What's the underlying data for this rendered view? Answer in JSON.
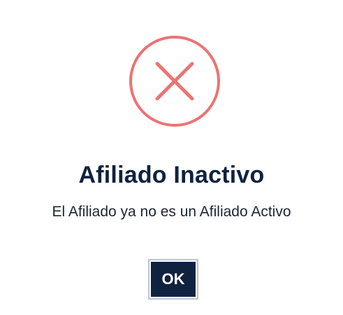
{
  "dialog": {
    "icon": "error-x-circle-icon",
    "icon_color": "#ec7373",
    "title": "Afiliado Inactivo",
    "message": "El Afiliado ya no es un Afiliado Activo",
    "ok_label": "OK",
    "title_color": "#0f2240",
    "button_color": "#0f2240"
  }
}
